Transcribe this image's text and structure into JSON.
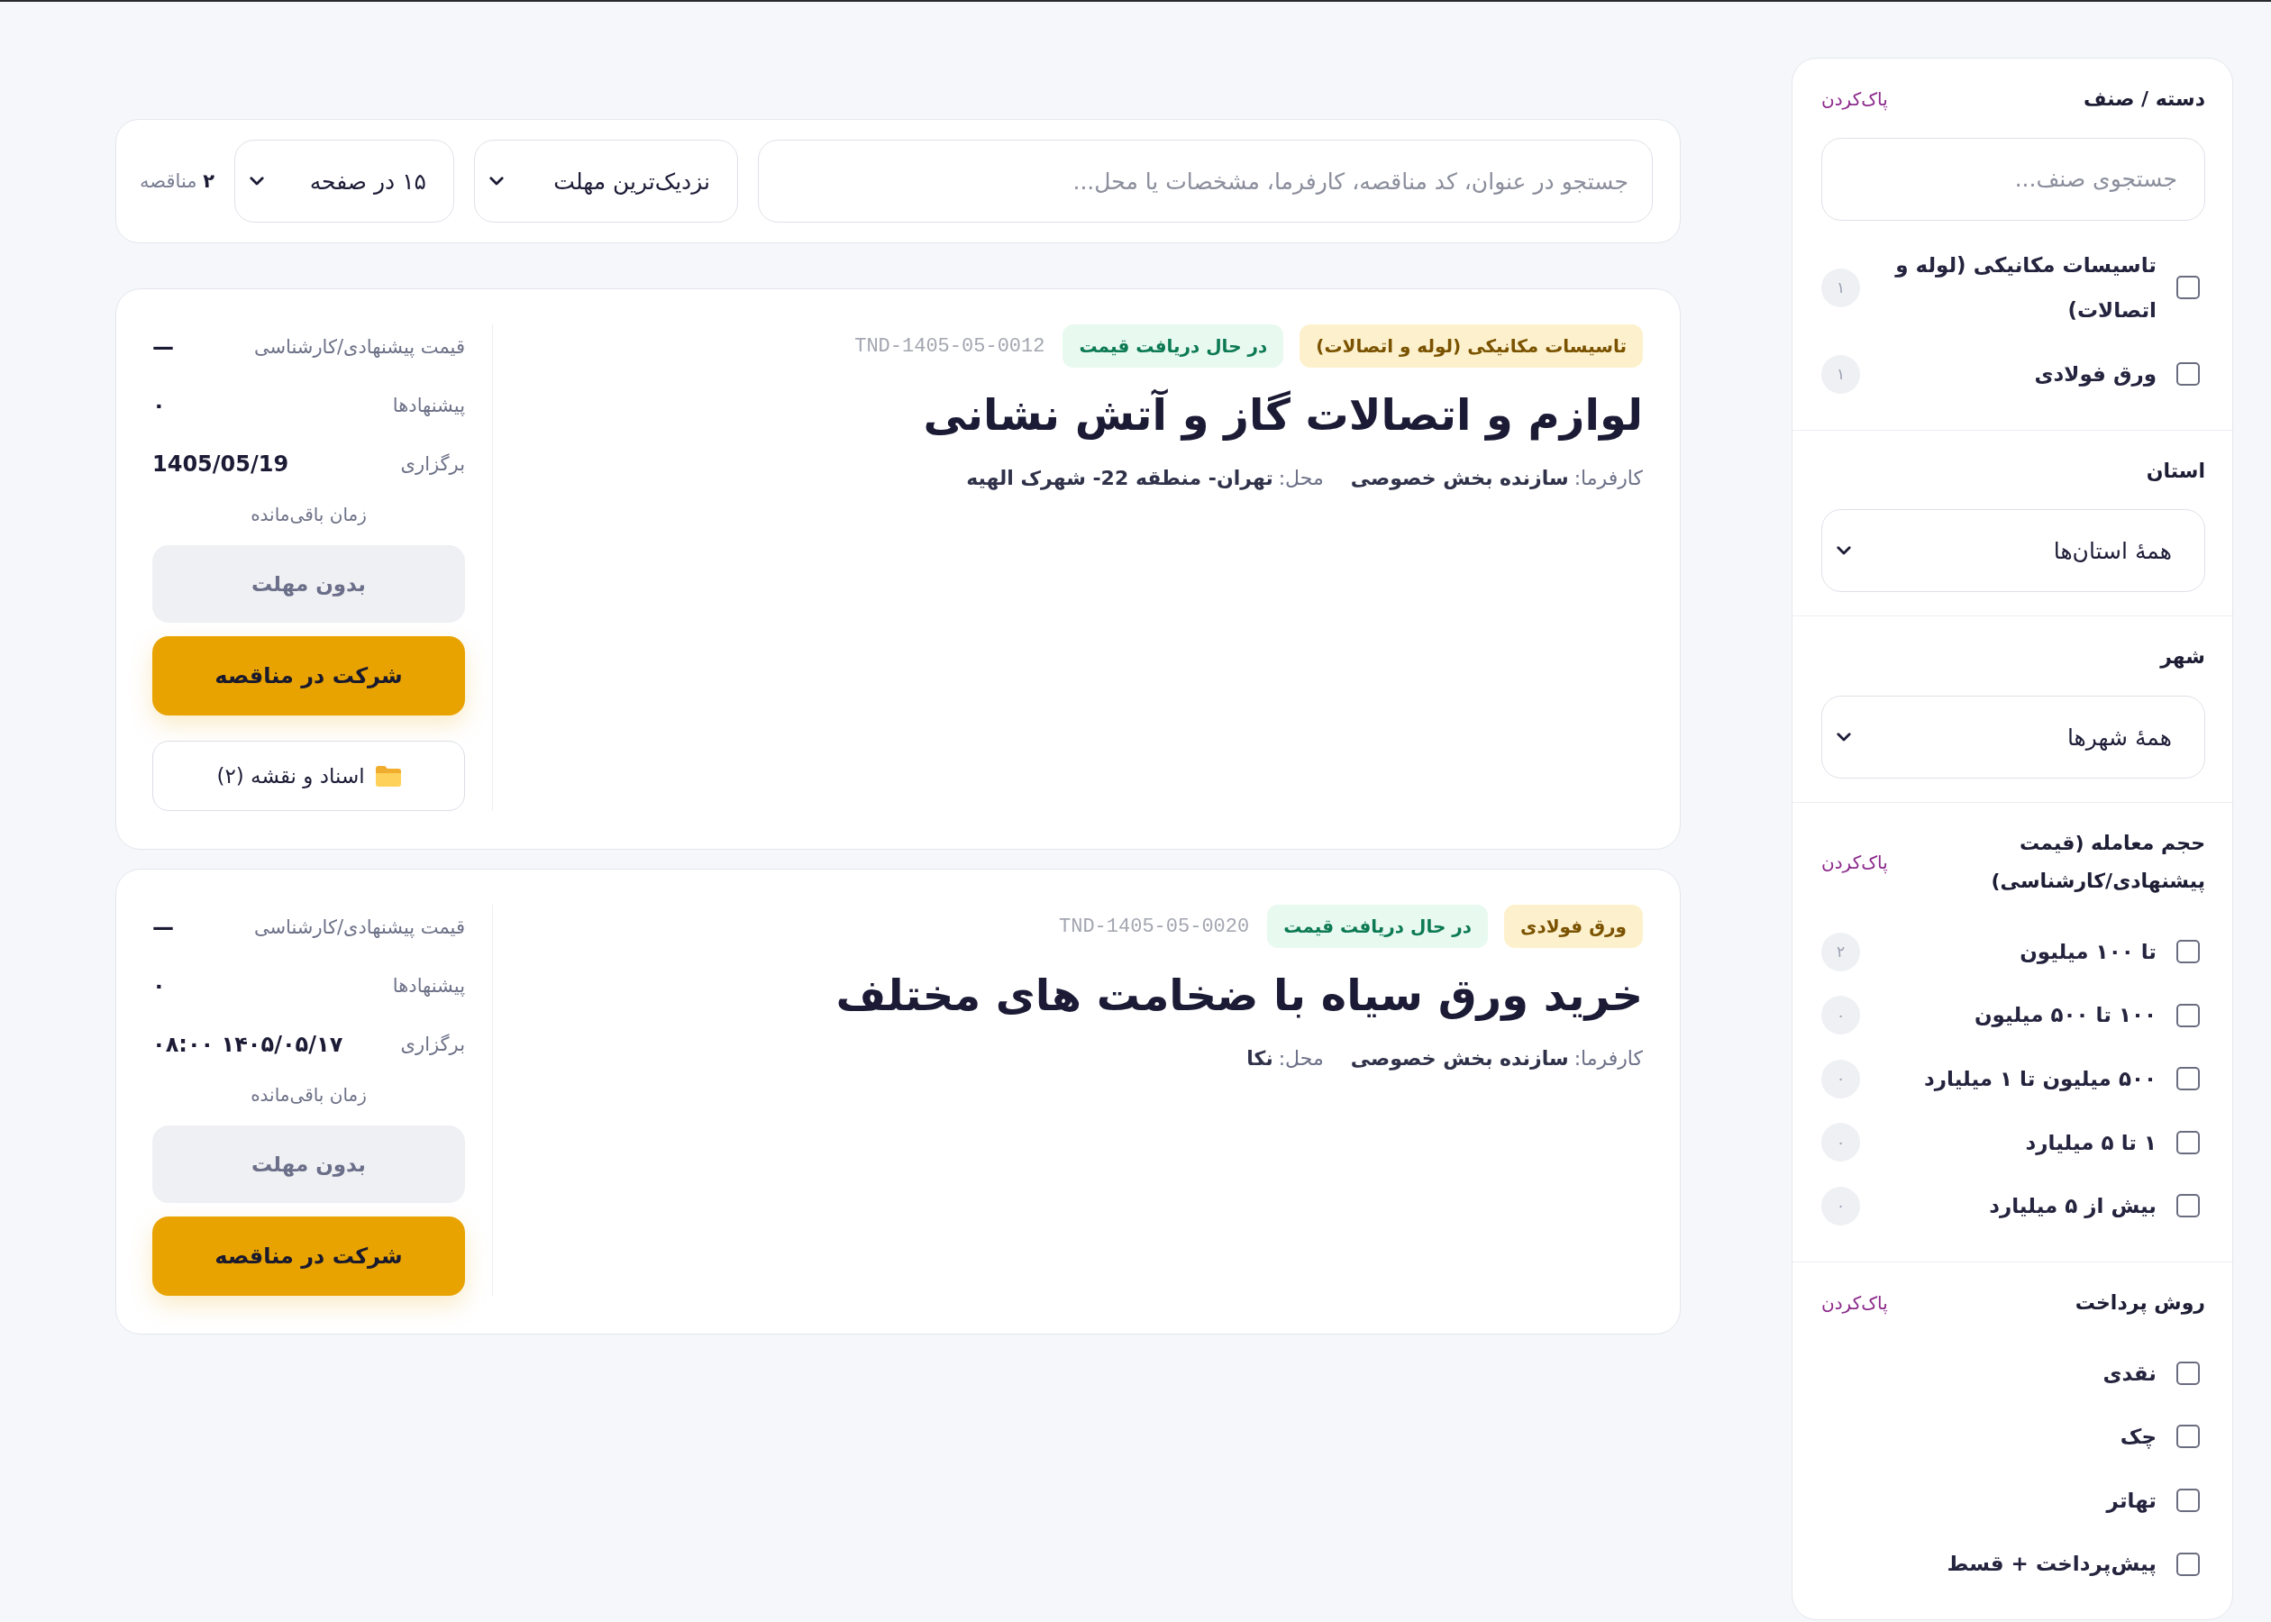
{
  "toolbar": {
    "search": {
      "placeholder": "جستجو در عنوان، کد مناقصه، کارفرما، مشخصات یا محل..."
    },
    "sort": {
      "value": "نزدیک‌ترین مهلت"
    },
    "page_size": {
      "value": "۱۵ در صفحه"
    },
    "result_count": "**۲** مناقصه"
  },
  "tenders": [
    {
      "tags": [
        {
          "kind": "category",
          "label": "تاسیسات مکانیکی (لوله و اتصالات)"
        },
        {
          "kind": "status",
          "label": "در حال دریافت قیمت"
        }
      ],
      "code": "TND-1405-05-0012",
      "title": "لوازم و اتصالات گاز و آتش نشانی",
      "meta": [
        {
          "label": "کارفرما:",
          "value": "سازنده بخش خصوصی"
        },
        {
          "label": "محل:",
          "value": "تهران- منطقه 22- شهرک الهیه"
        }
      ],
      "stats": [
        {
          "label": "قیمت پیشنهادی/کارشناسی",
          "value": "—"
        },
        {
          "label": "پیشنهادها",
          "value": "۰"
        },
        {
          "label": "برگزاری",
          "value": "1405/05/19"
        }
      ],
      "remaining_label": "زمان باقی‌مانده",
      "deadline": "بدون مهلت",
      "join_button": "شرکت در مناقصه",
      "documents_button": "اسناد و نقشه (۲)"
    },
    {
      "tags": [
        {
          "kind": "category",
          "label": "ورق فولادی"
        },
        {
          "kind": "status",
          "label": "در حال دریافت قیمت"
        }
      ],
      "code": "TND-1405-05-0020",
      "title": "خرید ورق سیاه با ضخامت های مختلف",
      "meta": [
        {
          "label": "کارفرما:",
          "value": "سازنده بخش خصوصی"
        },
        {
          "label": "محل:",
          "value": "نکا"
        }
      ],
      "stats": [
        {
          "label": "قیمت پیشنهادی/کارشناسی",
          "value": "—"
        },
        {
          "label": "پیشنهادها",
          "value": "۰"
        },
        {
          "label": "برگزاری",
          "value": "۱۴۰۵/۰۵/۱۷ ۰۸:۰۰"
        }
      ],
      "remaining_label": "زمان باقی‌مانده",
      "deadline": "بدون مهلت",
      "join_button": "شرکت در مناقصه"
    }
  ],
  "filter_sections": [
    {
      "kind": "checklist",
      "title": "دسته / صنف",
      "clear_link": "پاک‌کردن",
      "search": {
        "placeholder": "جستجوی صنف..."
      },
      "options": [
        {
          "label": "تاسیسات مکانیکی (لوله و اتصالات)",
          "checked": false,
          "count": "۱"
        },
        {
          "label": "ورق فولادی",
          "checked": false,
          "count": "۱"
        }
      ]
    },
    {
      "kind": "select",
      "title": "استان",
      "select": {
        "value": "همهٔ استان‌ها"
      }
    },
    {
      "kind": "select",
      "title": "شهر",
      "select": {
        "value": "همهٔ شهرها"
      }
    },
    {
      "kind": "checklist",
      "title": "حجم معامله (قیمت پیشنهادی/کارشناسی)",
      "clear_link": "پاک‌کردن",
      "options": [
        {
          "label": "تا ۱۰۰ میلیون",
          "checked": false,
          "count": "۲"
        },
        {
          "label": "۱۰۰ تا ۵۰۰ میلیون",
          "checked": false,
          "count": "۰"
        },
        {
          "label": "۵۰۰ میلیون تا ۱ میلیارد",
          "checked": false,
          "count": "۰"
        },
        {
          "label": "۱ تا ۵ میلیارد",
          "checked": false,
          "count": "۰"
        },
        {
          "label": "بیش از ۵ میلیارد",
          "checked": false,
          "count": "۰"
        }
      ]
    },
    {
      "kind": "checklist",
      "title": "روش پرداخت",
      "clear_link": "پاک‌کردن",
      "options": [
        {
          "label": "نقدی",
          "checked": false
        },
        {
          "label": "چک",
          "checked": false
        },
        {
          "label": "تهاتر",
          "checked": false
        },
        {
          "label": "پیش‌پرداخت + قسط",
          "checked": false
        }
      ]
    }
  ]
}
